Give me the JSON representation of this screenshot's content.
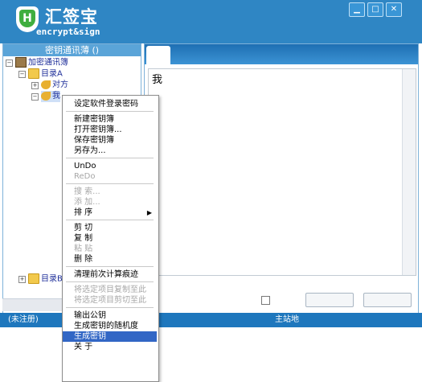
{
  "app": {
    "title": "汇签宝",
    "subtitle": "encrypt&sign",
    "window_controls": [
      "▁",
      "□",
      "✕"
    ]
  },
  "left_pane": {
    "title": "密钥通讯薄 ()",
    "tree": [
      {
        "label": "加密通讯簿",
        "level": 0,
        "icon": "address-book-icon"
      },
      {
        "label": "目录A",
        "level": 1,
        "icon": "folder-icon"
      },
      {
        "label": "对方",
        "level": 2,
        "icon": "key-icon"
      },
      {
        "label": "我",
        "level": 2,
        "icon": "key-icon",
        "selected": true
      },
      {
        "label": "目录B",
        "level": 1,
        "icon": "folder-icon"
      }
    ]
  },
  "editor": {
    "text": "我"
  },
  "status": {
    "left": "(未注册)",
    "right": "主站地址:HTTP://WWW.IHONGWENG.COM.CN"
  },
  "context_menu": {
    "items": [
      {
        "label": "设定软件登录密码",
        "disabled": false
      },
      {
        "sep": true
      },
      {
        "label": "新建密钥簿",
        "disabled": false
      },
      {
        "label": "打开密钥簿...",
        "disabled": false
      },
      {
        "label": "保存密钥簿",
        "disabled": false
      },
      {
        "label": "另存为...",
        "disabled": false
      },
      {
        "sep": true
      },
      {
        "label": "UnDo",
        "disabled": false
      },
      {
        "label": "ReDo",
        "disabled": true
      },
      {
        "sep": true
      },
      {
        "label": "搜   索...",
        "disabled": true
      },
      {
        "label": "添   加...",
        "disabled": true
      },
      {
        "label": "排   序",
        "disabled": false,
        "submenu": true
      },
      {
        "sep": true
      },
      {
        "label": "剪   切",
        "disabled": false
      },
      {
        "label": "复   制",
        "disabled": false
      },
      {
        "label": "粘   贴",
        "disabled": true
      },
      {
        "label": "删   除",
        "disabled": false
      },
      {
        "sep": true
      },
      {
        "label": "清理前次计算痕迹",
        "disabled": false
      },
      {
        "sep": true
      },
      {
        "label": "将选定项目复制至此",
        "disabled": true
      },
      {
        "label": "将选定项目剪切至此",
        "disabled": true
      },
      {
        "sep": true
      },
      {
        "label": "输出公钥",
        "disabled": false
      },
      {
        "label": "生成密钥的随机度",
        "disabled": false
      },
      {
        "label": "生成密钥",
        "disabled": false,
        "highlighted": true
      },
      {
        "label": "关   于",
        "disabled": false
      }
    ],
    "submenu_arrow": "▶"
  }
}
